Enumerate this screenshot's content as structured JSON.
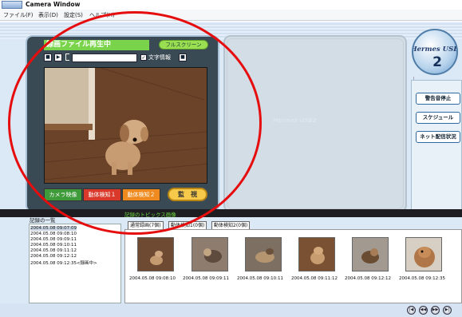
{
  "window": {
    "title": "Camera Window"
  },
  "menu": [
    {
      "label": "ファイル(F)"
    },
    {
      "label": "表示(D)"
    },
    {
      "label": "設定(S)"
    },
    {
      "label": "ヘルプ(H)"
    }
  ],
  "video_panel": {
    "title": "録画ファイル再生中",
    "fullscreen_label": "フルスクリーン",
    "checkbox_label": "文字情報",
    "checkbox_checked": "✓",
    "file_path": "",
    "buttons": [
      {
        "label": "カメラ映像",
        "color": "#3f9a3a"
      },
      {
        "label": "動体検知１",
        "color": "#d8392b"
      },
      {
        "label": "動体検知２",
        "color": "#ef8a1e"
      }
    ],
    "monitor_label": "監　視"
  },
  "center_panel": {
    "logo_text": "Hermes USB2"
  },
  "right_panel": {
    "buttons": [
      {
        "label": "警告音停止"
      },
      {
        "label": "スケジュール"
      },
      {
        "label": "ネット配信状況"
      }
    ],
    "logo": {
      "line1": "Hermes USB",
      "line2": "2"
    }
  },
  "log": {
    "label": "記録の一覧",
    "rows": [
      "2004.05.08 09:07:09",
      "2004.05.08 09:08:10",
      "2004.05.08 09:09:11",
      "2004.05.08 09:10:11",
      "2004.05.08 09:11:12",
      "2004.05.08 09:12:12",
      "2004.05.08 09:12:35<録画中>"
    ]
  },
  "topics": {
    "label": "記録のトピックス画像",
    "tabs": [
      {
        "label": "通常録画(7個)"
      },
      {
        "label": "動体検知1(0個)"
      },
      {
        "label": "動体検知2(0個)"
      }
    ],
    "thumbnails": [
      {
        "caption": "2004.05.08 09:08:10"
      },
      {
        "caption": "2004.05.08 09:09:11"
      },
      {
        "caption": "2004.05.08 09:10:11"
      },
      {
        "caption": "2004.05.08 09:11:12"
      },
      {
        "caption": "2004.05.08 09:12:12"
      },
      {
        "caption": "2004.05.08 09:12:35"
      }
    ]
  },
  "nav_buttons": [
    "|◀",
    "◀◀",
    "▶▶",
    "▶|"
  ],
  "colors": {
    "title_bg": "#7ad44b",
    "accent_blue": "#2f6aa5",
    "annotation": "#e50d0d"
  }
}
